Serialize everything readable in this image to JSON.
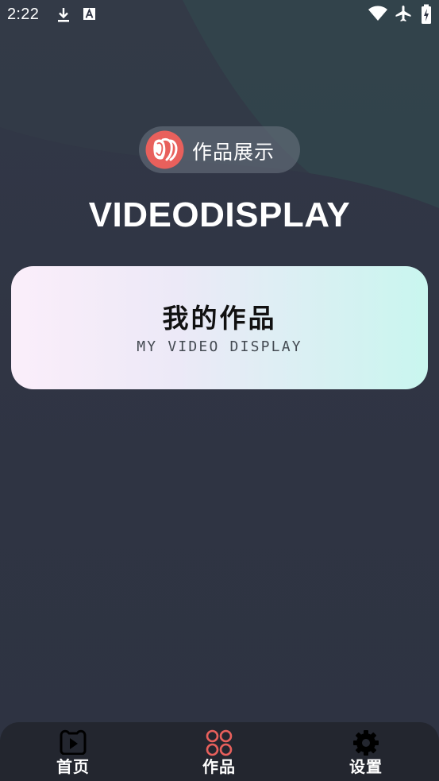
{
  "status_bar": {
    "time": "2:22",
    "icons": [
      "download-icon",
      "text-a-icon",
      "wifi-icon",
      "airplane-icon",
      "battery-charging-icon"
    ]
  },
  "colors": {
    "background": "#2f3444",
    "accent": "#e8605c",
    "card_gradient_start": "#fbeefa",
    "card_gradient_end": "#c9f6ef",
    "nav_background": "#23262f"
  },
  "header": {
    "badge_label": "作品展示",
    "badge_icon": "app-logo-icon",
    "title": "VIDEODISPLAY"
  },
  "card": {
    "title": "我的作品",
    "subtitle": "MY VIDEO DISPLAY"
  },
  "bottom_nav": {
    "items": [
      {
        "label": "首页",
        "icon": "video-play-icon",
        "active": false
      },
      {
        "label": "作品",
        "icon": "grid-circles-icon",
        "active": true
      },
      {
        "label": "设置",
        "icon": "gear-icon",
        "active": false
      }
    ]
  }
}
